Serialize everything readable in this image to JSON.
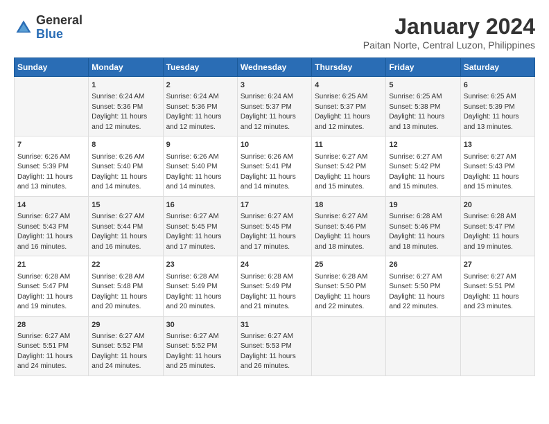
{
  "logo": {
    "general": "General",
    "blue": "Blue"
  },
  "title": "January 2024",
  "location": "Paitan Norte, Central Luzon, Philippines",
  "days_header": [
    "Sunday",
    "Monday",
    "Tuesday",
    "Wednesday",
    "Thursday",
    "Friday",
    "Saturday"
  ],
  "weeks": [
    [
      {
        "day": "",
        "content": ""
      },
      {
        "day": "1",
        "content": "Sunrise: 6:24 AM\nSunset: 5:36 PM\nDaylight: 11 hours\nand 12 minutes."
      },
      {
        "day": "2",
        "content": "Sunrise: 6:24 AM\nSunset: 5:36 PM\nDaylight: 11 hours\nand 12 minutes."
      },
      {
        "day": "3",
        "content": "Sunrise: 6:24 AM\nSunset: 5:37 PM\nDaylight: 11 hours\nand 12 minutes."
      },
      {
        "day": "4",
        "content": "Sunrise: 6:25 AM\nSunset: 5:37 PM\nDaylight: 11 hours\nand 12 minutes."
      },
      {
        "day": "5",
        "content": "Sunrise: 6:25 AM\nSunset: 5:38 PM\nDaylight: 11 hours\nand 13 minutes."
      },
      {
        "day": "6",
        "content": "Sunrise: 6:25 AM\nSunset: 5:39 PM\nDaylight: 11 hours\nand 13 minutes."
      }
    ],
    [
      {
        "day": "7",
        "content": "Sunrise: 6:26 AM\nSunset: 5:39 PM\nDaylight: 11 hours\nand 13 minutes."
      },
      {
        "day": "8",
        "content": "Sunrise: 6:26 AM\nSunset: 5:40 PM\nDaylight: 11 hours\nand 14 minutes."
      },
      {
        "day": "9",
        "content": "Sunrise: 6:26 AM\nSunset: 5:40 PM\nDaylight: 11 hours\nand 14 minutes."
      },
      {
        "day": "10",
        "content": "Sunrise: 6:26 AM\nSunset: 5:41 PM\nDaylight: 11 hours\nand 14 minutes."
      },
      {
        "day": "11",
        "content": "Sunrise: 6:27 AM\nSunset: 5:42 PM\nDaylight: 11 hours\nand 15 minutes."
      },
      {
        "day": "12",
        "content": "Sunrise: 6:27 AM\nSunset: 5:42 PM\nDaylight: 11 hours\nand 15 minutes."
      },
      {
        "day": "13",
        "content": "Sunrise: 6:27 AM\nSunset: 5:43 PM\nDaylight: 11 hours\nand 15 minutes."
      }
    ],
    [
      {
        "day": "14",
        "content": "Sunrise: 6:27 AM\nSunset: 5:43 PM\nDaylight: 11 hours\nand 16 minutes."
      },
      {
        "day": "15",
        "content": "Sunrise: 6:27 AM\nSunset: 5:44 PM\nDaylight: 11 hours\nand 16 minutes."
      },
      {
        "day": "16",
        "content": "Sunrise: 6:27 AM\nSunset: 5:45 PM\nDaylight: 11 hours\nand 17 minutes."
      },
      {
        "day": "17",
        "content": "Sunrise: 6:27 AM\nSunset: 5:45 PM\nDaylight: 11 hours\nand 17 minutes."
      },
      {
        "day": "18",
        "content": "Sunrise: 6:27 AM\nSunset: 5:46 PM\nDaylight: 11 hours\nand 18 minutes."
      },
      {
        "day": "19",
        "content": "Sunrise: 6:28 AM\nSunset: 5:46 PM\nDaylight: 11 hours\nand 18 minutes."
      },
      {
        "day": "20",
        "content": "Sunrise: 6:28 AM\nSunset: 5:47 PM\nDaylight: 11 hours\nand 19 minutes."
      }
    ],
    [
      {
        "day": "21",
        "content": "Sunrise: 6:28 AM\nSunset: 5:47 PM\nDaylight: 11 hours\nand 19 minutes."
      },
      {
        "day": "22",
        "content": "Sunrise: 6:28 AM\nSunset: 5:48 PM\nDaylight: 11 hours\nand 20 minutes."
      },
      {
        "day": "23",
        "content": "Sunrise: 6:28 AM\nSunset: 5:49 PM\nDaylight: 11 hours\nand 20 minutes."
      },
      {
        "day": "24",
        "content": "Sunrise: 6:28 AM\nSunset: 5:49 PM\nDaylight: 11 hours\nand 21 minutes."
      },
      {
        "day": "25",
        "content": "Sunrise: 6:28 AM\nSunset: 5:50 PM\nDaylight: 11 hours\nand 22 minutes."
      },
      {
        "day": "26",
        "content": "Sunrise: 6:27 AM\nSunset: 5:50 PM\nDaylight: 11 hours\nand 22 minutes."
      },
      {
        "day": "27",
        "content": "Sunrise: 6:27 AM\nSunset: 5:51 PM\nDaylight: 11 hours\nand 23 minutes."
      }
    ],
    [
      {
        "day": "28",
        "content": "Sunrise: 6:27 AM\nSunset: 5:51 PM\nDaylight: 11 hours\nand 24 minutes."
      },
      {
        "day": "29",
        "content": "Sunrise: 6:27 AM\nSunset: 5:52 PM\nDaylight: 11 hours\nand 24 minutes."
      },
      {
        "day": "30",
        "content": "Sunrise: 6:27 AM\nSunset: 5:52 PM\nDaylight: 11 hours\nand 25 minutes."
      },
      {
        "day": "31",
        "content": "Sunrise: 6:27 AM\nSunset: 5:53 PM\nDaylight: 11 hours\nand 26 minutes."
      },
      {
        "day": "",
        "content": ""
      },
      {
        "day": "",
        "content": ""
      },
      {
        "day": "",
        "content": ""
      }
    ]
  ]
}
